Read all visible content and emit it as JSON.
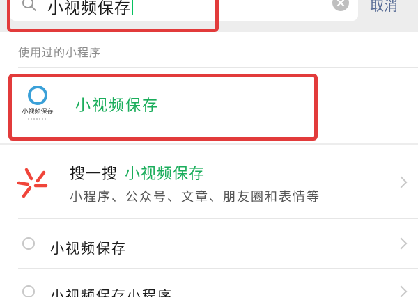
{
  "search": {
    "query": "小视频保存",
    "cancel_label": "取消"
  },
  "recent": {
    "section_label": "使用过的小程序",
    "app_name": "小视频保存",
    "logo_text": "小视频保存"
  },
  "sousou": {
    "title": "搜一搜",
    "query": "小视频保存",
    "subtitle": "小程序、公众号、文章、朋友圈和表情等"
  },
  "suggestions": [
    {
      "text": "小视频保存"
    },
    {
      "text": "小视频保存小程序"
    }
  ],
  "colors": {
    "accent_green": "#1aad5b",
    "highlight_red": "#e23b3b",
    "link_blue": "#576b95"
  }
}
